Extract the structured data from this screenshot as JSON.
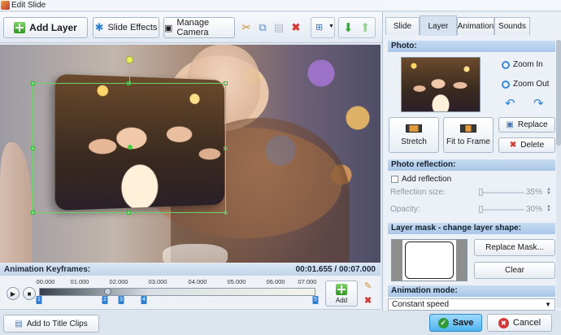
{
  "window": {
    "title": "Edit Slide"
  },
  "toolbar": {
    "add_layer": "Add Layer",
    "slide_effects": "Slide Effects",
    "manage_camera": "Manage Camera"
  },
  "timeline": {
    "header_label": "Animation Keyframes:",
    "time_readout": "00:01.655 / 00:07.000",
    "ticks": [
      "00.000",
      "01.000",
      "02.000",
      "03.000",
      "04.000",
      "05.000",
      "06.000",
      "07.000"
    ],
    "markers": [
      "1",
      "2",
      "3",
      "4",
      "5"
    ],
    "add_label": "Add",
    "playhead_position": 0.236
  },
  "tabs": {
    "slide": "Slide",
    "layer": "Layer",
    "animation": "Animation",
    "sounds": "Sounds",
    "active": "Layer"
  },
  "photo": {
    "section_title": "Photo:",
    "zoom_in": "Zoom In",
    "zoom_out": "Zoom Out",
    "replace": "Replace",
    "delete": "Delete",
    "stretch": "Stretch",
    "fit_to_frame": "Fit to Frame"
  },
  "reflection": {
    "section_title": "Photo reflection:",
    "add_reflection": "Add reflection",
    "size_label": "Reflection size:",
    "size_value": "35%",
    "opacity_label": "Opacity:",
    "opacity_value": "30%"
  },
  "mask": {
    "section_title": "Layer mask - change layer shape:",
    "replace_mask": "Replace Mask...",
    "clear": "Clear"
  },
  "animation_mode": {
    "section_title": "Animation mode:",
    "selected": "Constant speed"
  },
  "footer": {
    "add_to_title_clips": "Add to Title Clips",
    "save": "Save",
    "cancel": "Cancel"
  },
  "colors": {
    "accent": "#4fb3ef",
    "section_header": "#a9c6e8",
    "marker": "#2f7fd3",
    "selection": "#6ad36a"
  }
}
